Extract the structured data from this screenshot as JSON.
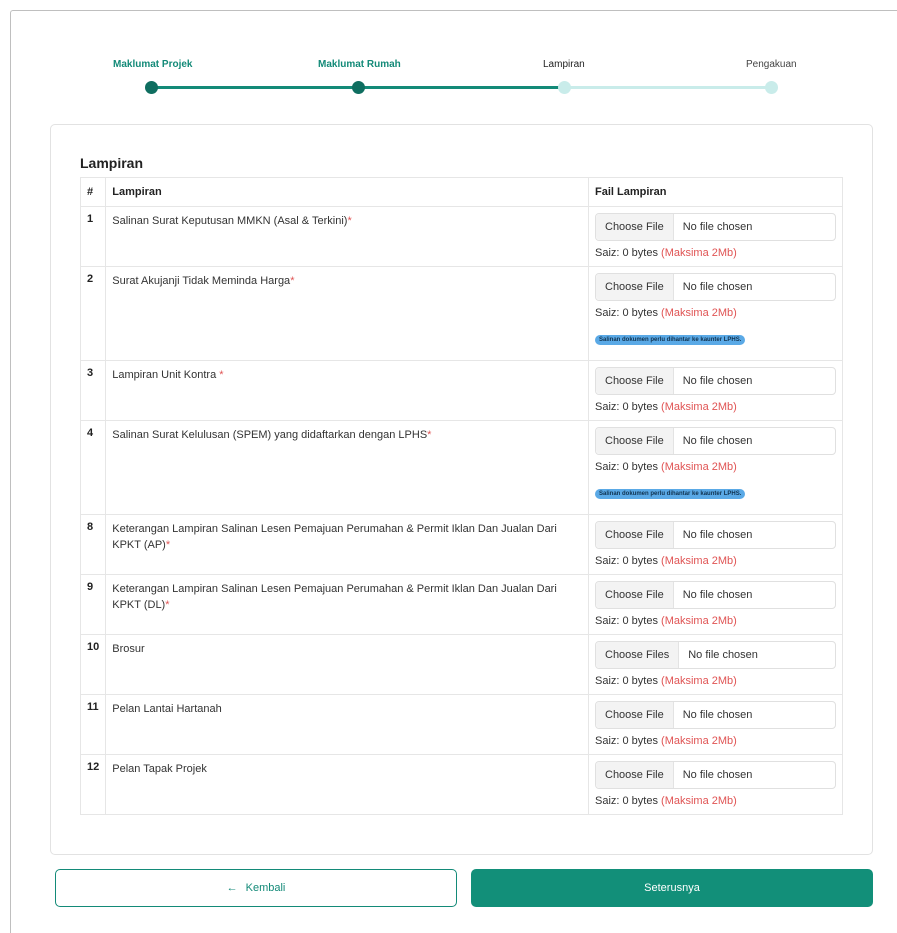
{
  "stepper": {
    "steps": [
      {
        "label": "Maklumat Projek",
        "state": "done"
      },
      {
        "label": "Maklumat Rumah",
        "state": "done"
      },
      {
        "label": "Lampiran",
        "state": "active"
      },
      {
        "label": "Pengakuan",
        "state": "todo"
      }
    ]
  },
  "section": {
    "title": "Lampiran",
    "headers": {
      "num": "#",
      "name": "Lampiran",
      "file": "Fail Lampiran"
    }
  },
  "rows": [
    {
      "num": "1",
      "name": "Salinan Surat Keputusan MMKN (Asal & Terkini)",
      "req": "*",
      "btn": "Choose File",
      "status": "No file chosen",
      "size": "Saiz: 0 bytes",
      "max": "(Maksima 2Mb)",
      "note": ""
    },
    {
      "num": "2",
      "name": "Surat Akujanji Tidak Meminda Harga",
      "req": "*",
      "btn": "Choose File",
      "status": "No file chosen",
      "size": "Saiz: 0 bytes",
      "max": "(Maksima 2Mb)",
      "note": "Salinan dokumen perlu dihantar ke kaunter LPHS."
    },
    {
      "num": "3",
      "name": "Lampiran Unit Kontra ",
      "req": "*",
      "btn": "Choose File",
      "status": "No file chosen",
      "size": "Saiz: 0 bytes",
      "max": "(Maksima 2Mb)",
      "note": ""
    },
    {
      "num": "4",
      "name": "Salinan Surat Kelulusan (SPEM) yang didaftarkan dengan LPHS",
      "req": "*",
      "btn": "Choose File",
      "status": "No file chosen",
      "size": "Saiz: 0 bytes",
      "max": "(Maksima 2Mb)",
      "note": "Salinan dokumen perlu dihantar ke kaunter LPHS."
    },
    {
      "num": "8",
      "name": "Keterangan Lampiran Salinan Lesen Pemajuan Perumahan & Permit Iklan Dan Jualan Dari KPKT (AP)",
      "req": "*",
      "btn": "Choose File",
      "status": "No file chosen",
      "size": "Saiz: 0 bytes",
      "max": "(Maksima 2Mb)",
      "note": ""
    },
    {
      "num": "9",
      "name": "Keterangan Lampiran Salinan Lesen Pemajuan Perumahan & Permit Iklan Dan Jualan Dari KPKT (DL)",
      "req": "*",
      "btn": "Choose File",
      "status": "No file chosen",
      "size": "Saiz: 0 bytes",
      "max": "(Maksima 2Mb)",
      "note": ""
    },
    {
      "num": "10",
      "name": "Brosur",
      "req": "",
      "btn": "Choose Files",
      "status": "No file chosen",
      "size": "Saiz: 0 bytes",
      "max": "(Maksima 2Mb)",
      "note": ""
    },
    {
      "num": "11",
      "name": "Pelan Lantai Hartanah",
      "req": "",
      "btn": "Choose File",
      "status": "No file chosen",
      "size": "Saiz: 0 bytes",
      "max": "(Maksima 2Mb)",
      "note": ""
    },
    {
      "num": "12",
      "name": "Pelan Tapak Projek",
      "req": "",
      "btn": "Choose File",
      "status": "No file chosen",
      "size": "Saiz: 0 bytes",
      "max": "(Maksima 2Mb)",
      "note": ""
    }
  ],
  "footer": {
    "back_icon": "←",
    "back_label": "Kembali",
    "next_label": "Seterusnya"
  },
  "colors": {
    "primary": "#128f79",
    "required": "#e05454",
    "badge": "#5aa9e6",
    "step_light": "#c9ecea"
  }
}
